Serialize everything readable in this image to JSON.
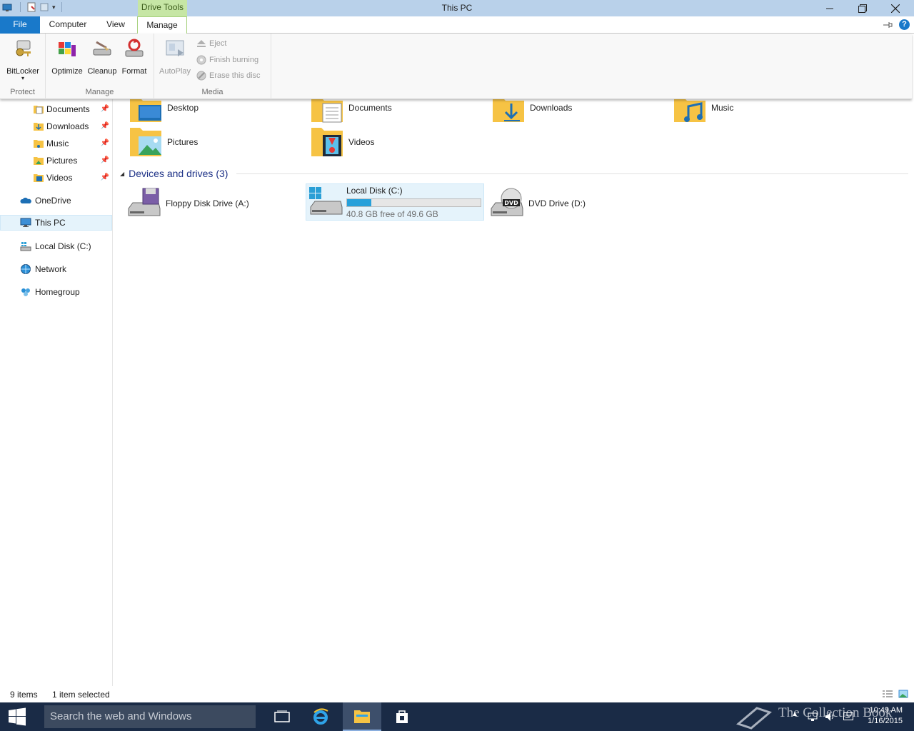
{
  "window": {
    "title": "This PC",
    "context_tab": "Drive Tools"
  },
  "ribbon_tabs": {
    "file": "File",
    "computer": "Computer",
    "view": "View",
    "manage": "Manage"
  },
  "ribbon": {
    "protect": {
      "label": "Protect",
      "bitlocker": "BitLocker"
    },
    "manage": {
      "label": "Manage",
      "optimize": "Optimize",
      "cleanup": "Cleanup",
      "format": "Format"
    },
    "media": {
      "label": "Media",
      "autoplay": "AutoPlay",
      "eject": "Eject",
      "finish_burning": "Finish burning",
      "erase_disc": "Erase this disc"
    }
  },
  "nav": {
    "documents": "Documents",
    "downloads": "Downloads",
    "music": "Music",
    "pictures": "Pictures",
    "videos": "Videos",
    "onedrive": "OneDrive",
    "this_pc": "This PC",
    "local_disk": "Local Disk (C:)",
    "network": "Network",
    "homegroup": "Homegroup"
  },
  "folders": {
    "desktop": "Desktop",
    "documents": "Documents",
    "downloads": "Downloads",
    "music": "Music",
    "pictures": "Pictures",
    "videos": "Videos"
  },
  "devices": {
    "header": "Devices and drives (3)",
    "floppy": "Floppy Disk Drive (A:)",
    "local_disk": {
      "name": "Local Disk (C:)",
      "free_text": "40.8 GB free of 49.6 GB",
      "used_fraction": 0.18
    },
    "dvd": "DVD Drive (D:)"
  },
  "status": {
    "items": "9 items",
    "selected": "1 item selected"
  },
  "taskbar": {
    "search_placeholder": "Search the web and Windows",
    "time": "10:49 AM",
    "date": "1/16/2015",
    "watermark": "The Collection Book"
  },
  "colors": {
    "accent": "#1979ca",
    "drive_tools": "#c6e6a5",
    "taskbar": "#1a2b46",
    "capacity_bar": "#26a0da"
  }
}
